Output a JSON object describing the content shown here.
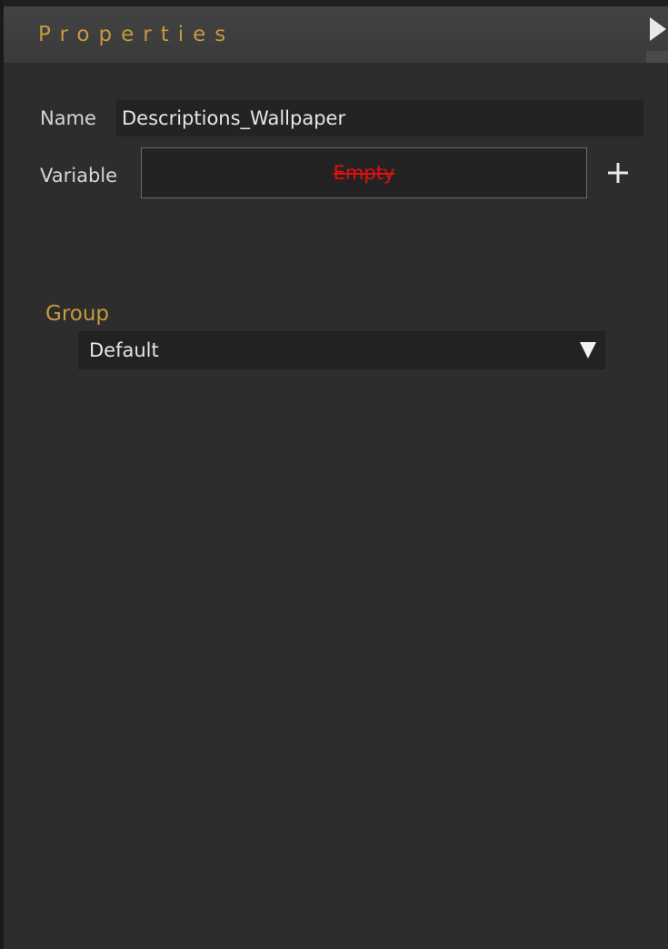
{
  "header": {
    "title": "Properties",
    "collapse_icon": "triangle-right-icon"
  },
  "name": {
    "label": "Name",
    "value": "Descriptions_Wallpaper"
  },
  "variable": {
    "label": "Variable",
    "value": "Empty",
    "add_icon": "plus-icon"
  },
  "group": {
    "label": "Group",
    "selected": "Default",
    "dropdown_icon": "triangle-down-icon"
  },
  "colors": {
    "background": "#2d2d2d",
    "header": "#3d3d3d",
    "accent": "#c49a3f",
    "empty_value": "#e01010",
    "field": "#232323"
  }
}
